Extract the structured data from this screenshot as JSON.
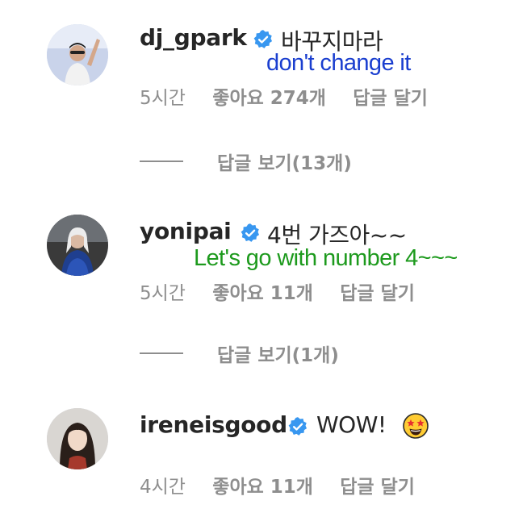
{
  "comments": [
    {
      "username": "dj_gpark",
      "text": "바꾸지마라",
      "translation": "don't change it",
      "translation_color": "#1a3ecf",
      "time": "5시간",
      "likes": "좋아요 274개",
      "reply": "답글 달기",
      "view_replies": "답글 보기(13개)"
    },
    {
      "username": "yonipai",
      "text": "4번 가즈아~~",
      "translation": "Let's go with number 4~~~",
      "translation_color": "#1d9a1d",
      "time": "5시간",
      "likes": "좋아요 11개",
      "reply": "답글 달기",
      "view_replies": "답글 보기(1개)"
    },
    {
      "username": "ireneisgood",
      "text": "WOW!",
      "emoji": "star-struck-emoji",
      "time": "4시간",
      "likes": "좋아요 11개",
      "reply": "답글 달기"
    }
  ],
  "colors": {
    "verified_badge": "#3897f0",
    "meta_text": "#8e8e8e"
  }
}
